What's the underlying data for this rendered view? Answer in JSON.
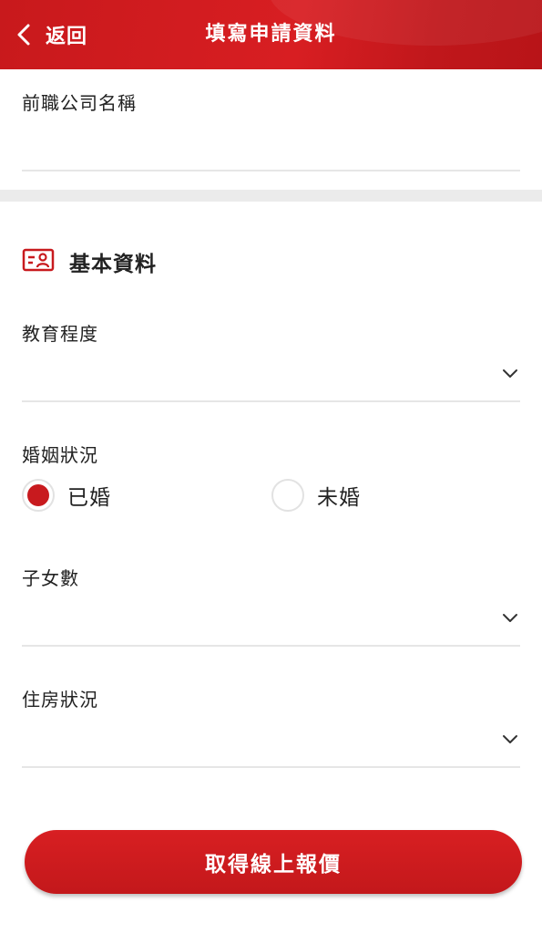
{
  "header": {
    "back_label": "返回",
    "title": "填寫申請資料"
  },
  "fields": {
    "previous_company": {
      "label": "前職公司名稱",
      "value": ""
    },
    "education": {
      "label": "教育程度",
      "value": ""
    },
    "marital_status": {
      "label": "婚姻狀況",
      "options": [
        {
          "label": "已婚",
          "selected": true
        },
        {
          "label": "未婚",
          "selected": false
        }
      ]
    },
    "children": {
      "label": "子女數",
      "value": ""
    },
    "housing": {
      "label": "住房狀況",
      "value": ""
    }
  },
  "section": {
    "title": "基本資料",
    "icon": "id-card-icon"
  },
  "cta": {
    "label": "取得線上報價"
  },
  "colors": {
    "brand_red": "#c81a1e",
    "divider": "#e6e6e6",
    "section_gap": "#ebebeb"
  }
}
